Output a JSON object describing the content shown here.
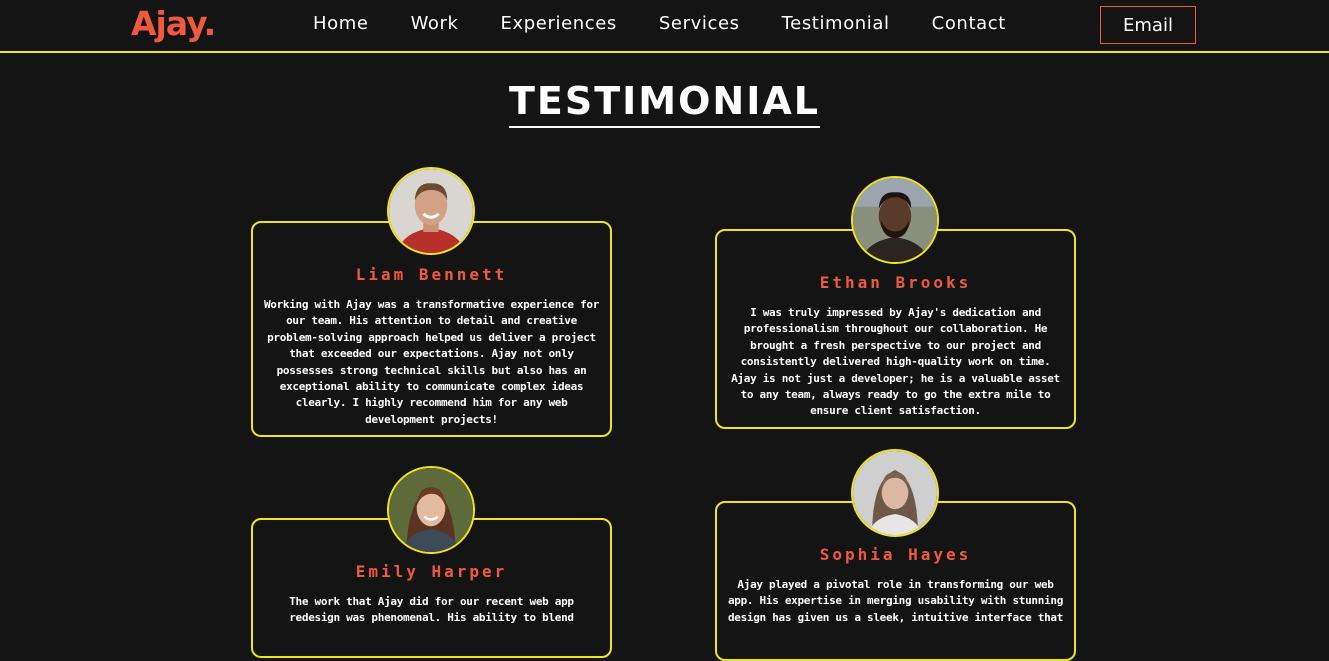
{
  "brand": {
    "logo": "Ajay."
  },
  "nav": {
    "items": [
      "Home",
      "Work",
      "Experiences",
      "Services",
      "Testimonial",
      "Contact"
    ],
    "email_label": "Email"
  },
  "section": {
    "title": "TESTIMONIAL"
  },
  "colors": {
    "accent": "#f05a3c",
    "border": "#f2e41c",
    "background": "#141414"
  },
  "testimonials": [
    {
      "name": "Liam Bennett",
      "avatar_icon": "man-smiling-photo",
      "text": "Working with Ajay was a transformative experience for our team. His attention to detail and creative problem-solving approach helped us deliver a project that exceeded our expectations. Ajay not only possesses strong technical skills but also has an exceptional ability to communicate complex ideas clearly. I highly recommend him for any web development projects!"
    },
    {
      "name": "Ethan Brooks",
      "avatar_icon": "man-beard-photo",
      "text": "I was truly impressed by Ajay's dedication and professionalism throughout our collaboration. He brought a fresh perspective to our project and consistently delivered high-quality work on time. Ajay is not just a developer; he is a valuable asset to any team, always ready to go the extra mile to ensure client satisfaction."
    },
    {
      "name": "Emily Harper",
      "avatar_icon": "woman-smiling-photo",
      "text": "The work that Ajay did for our recent web app redesign was phenomenal. His ability to blend"
    },
    {
      "name": "Sophia Hayes",
      "avatar_icon": "woman-portrait-photo",
      "text": "Ajay played a pivotal role in transforming our web app. His expertise in merging usability with stunning design has given us a sleek, intuitive interface that"
    }
  ]
}
